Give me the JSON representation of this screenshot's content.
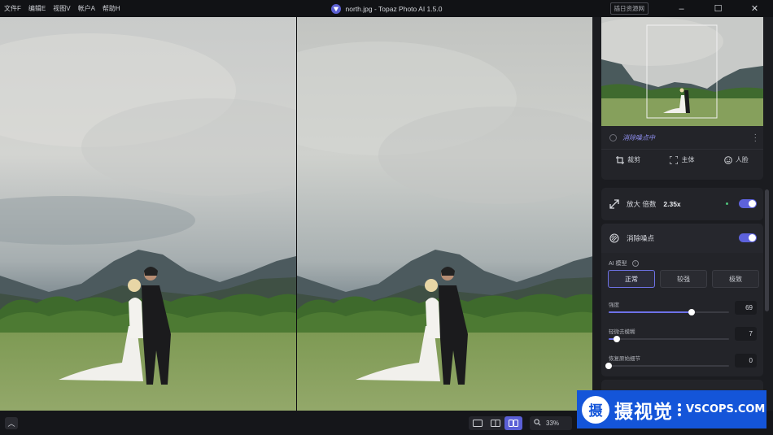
{
  "titlebar": {
    "menu": [
      "文件F",
      "编辑E",
      "视图V",
      "帐户A",
      "帮助H"
    ],
    "title": "north.jpg - Topaz Photo AI 1.5.0",
    "resource_button": "插日资源网",
    "minimize": "–",
    "maximize": "☐",
    "close": "✕"
  },
  "panel": {
    "status": "消除噪点中",
    "tools": {
      "crop": "裁剪",
      "subject": "主体",
      "face": "人脸"
    },
    "upscale": {
      "label": "放大 倍数",
      "value": "2.35x",
      "enabled": true
    },
    "denoise": {
      "label": "消除噪点",
      "enabled": true,
      "ai_model_label": "AI 模型",
      "modes": [
        "正常",
        "较强",
        "极致"
      ],
      "active_mode": "正常",
      "sliders": [
        {
          "label": "强度",
          "value": "69",
          "fraction": 0.69
        },
        {
          "label": "轻微去模糊",
          "value": "7",
          "fraction": 0.07
        },
        {
          "label": "恢复原始细节",
          "value": "0",
          "fraction": 0.0
        }
      ]
    }
  },
  "bottombar": {
    "zoom": "33%"
  },
  "watermark": {
    "seal": "摄",
    "cn": "摄视觉",
    "en": "VSCOPS.COM"
  },
  "colors": {
    "accent": "#5d62dc",
    "panel_bg": "#1b1c20",
    "card_bg": "#232429",
    "watermark_blue": "#1455d9"
  }
}
